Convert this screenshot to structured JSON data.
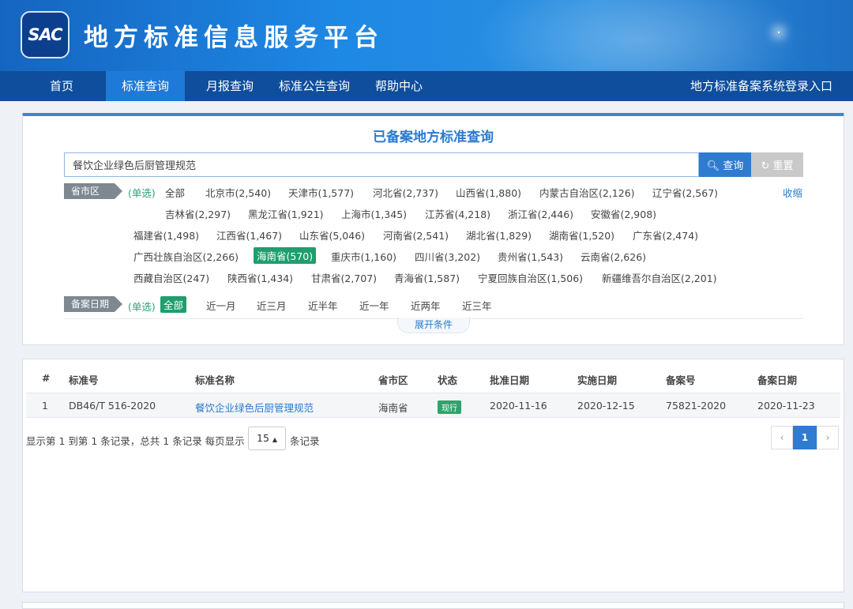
{
  "header": {
    "logo_text": "SAC",
    "site_title": "地方标准信息服务平台"
  },
  "nav": {
    "items": [
      "首页",
      "标准查询",
      "月报查询",
      "标准公告查询",
      "帮助中心"
    ],
    "active": "标准查询",
    "login_link": "地方标准备案系统登录入口"
  },
  "search": {
    "title": "已备案地方标准查询",
    "query_value": "餐饮企业绿色后厨管理规范",
    "query_button": "查询",
    "reset_button": "重置",
    "single_select": "(单选)",
    "collapse_label": "收缩",
    "expand_label": "展开条件",
    "province_label": "省市区",
    "provinces": [
      "全部",
      "北京市(2,540)",
      "天津市(1,577)",
      "河北省(2,737)",
      "山西省(1,880)",
      "内蒙古自治区(2,126)",
      "辽宁省(2,567)",
      "吉林省(2,297)",
      "黑龙江省(1,921)",
      "上海市(1,345)",
      "江苏省(4,218)",
      "浙江省(2,446)",
      "安徽省(2,908)",
      "福建省(1,498)",
      "江西省(1,467)",
      "山东省(5,046)",
      "河南省(2,541)",
      "湖北省(1,829)",
      "湖南省(1,520)",
      "广东省(2,474)",
      "广西壮族自治区(2,266)",
      "海南省(570)",
      "重庆市(1,160)",
      "四川省(3,202)",
      "贵州省(1,543)",
      "云南省(2,626)",
      "西藏自治区(247)",
      "陕西省(1,434)",
      "甘肃省(2,707)",
      "青海省(1,587)",
      "宁夏回族自治区(1,506)",
      "新疆维吾尔自治区(2,201)"
    ],
    "active_province": "海南省(570)",
    "date_label": "备案日期",
    "dates": [
      "全部",
      "近一月",
      "近三月",
      "近半年",
      "近一年",
      "近两年",
      "近三年"
    ],
    "active_date": "全部"
  },
  "table": {
    "headers": [
      "#",
      "标准号",
      "标准名称",
      "省市区",
      "状态",
      "批准日期",
      "实施日期",
      "备案号",
      "备案日期"
    ],
    "rows": [
      [
        "1",
        "DB46/T 516-2020",
        "餐饮企业绿色后厨管理规范",
        "海南省",
        "现行",
        "2020-11-16",
        "2020-12-15",
        "75821-2020",
        "2020-11-23"
      ]
    ],
    "page_info": "显示第 1 到第 1 条记录，总共 1 条记录 每页显示",
    "page_size": "15",
    "page_size_tail": "条记录",
    "prev": "‹",
    "current_page": "1",
    "next": "›"
  },
  "colors": {
    "nav_bg": "#0f4e9c",
    "accent": "#2f7bd0",
    "active_green": "#1f9e6f"
  }
}
